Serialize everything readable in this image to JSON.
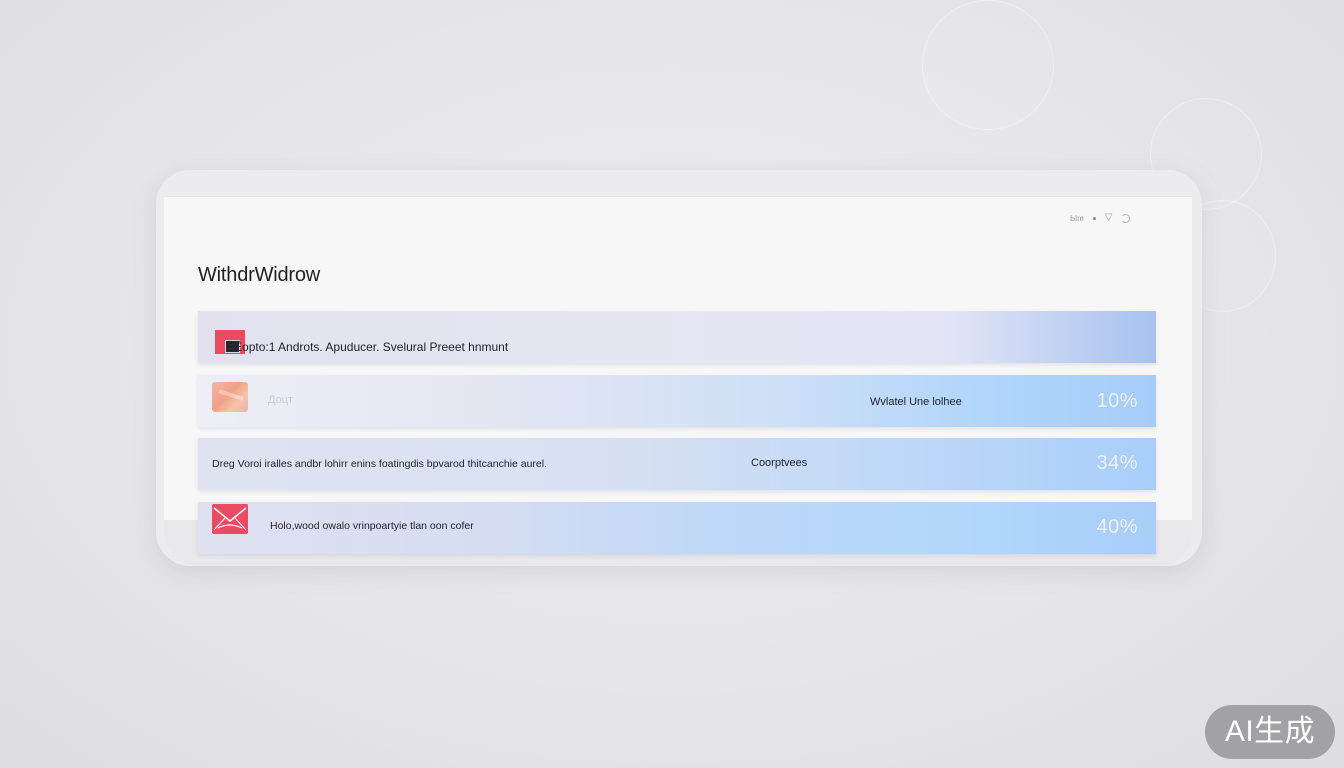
{
  "window": {
    "title": "WithdrWidrow"
  },
  "rows": [
    {
      "text": "ЁЁopto:1 Androts. Apuducer. Svelural Preeet hnmunt",
      "middle": "",
      "percent": ""
    },
    {
      "text": "Доцт",
      "middle": "Wvlatel Une lolhee",
      "percent": "10%"
    },
    {
      "text": "Dreg Voroi iralles andbr lohirr enins foatingdis bpvarod thitcanchie aurel.",
      "middle": "Coorptvees",
      "percent": "34%"
    },
    {
      "text": "Holo,wood owalo vrinpoartyie tlan oon cofer",
      "middle": "",
      "percent": "40%"
    }
  ],
  "icons": {
    "row1": "app-icon",
    "row2": "image-thumbnail-icon",
    "row4": "mail-icon",
    "tray": [
      "tray-text",
      "dot-icon",
      "wifi-icon",
      "moon-icon"
    ]
  },
  "tray": {
    "text": "Ыm"
  },
  "watermark": {
    "label": "AI生成"
  },
  "colors": {
    "accent_red": "#ea4a62",
    "row_blue": "#a8cef9",
    "background": "#e4e4e8"
  }
}
